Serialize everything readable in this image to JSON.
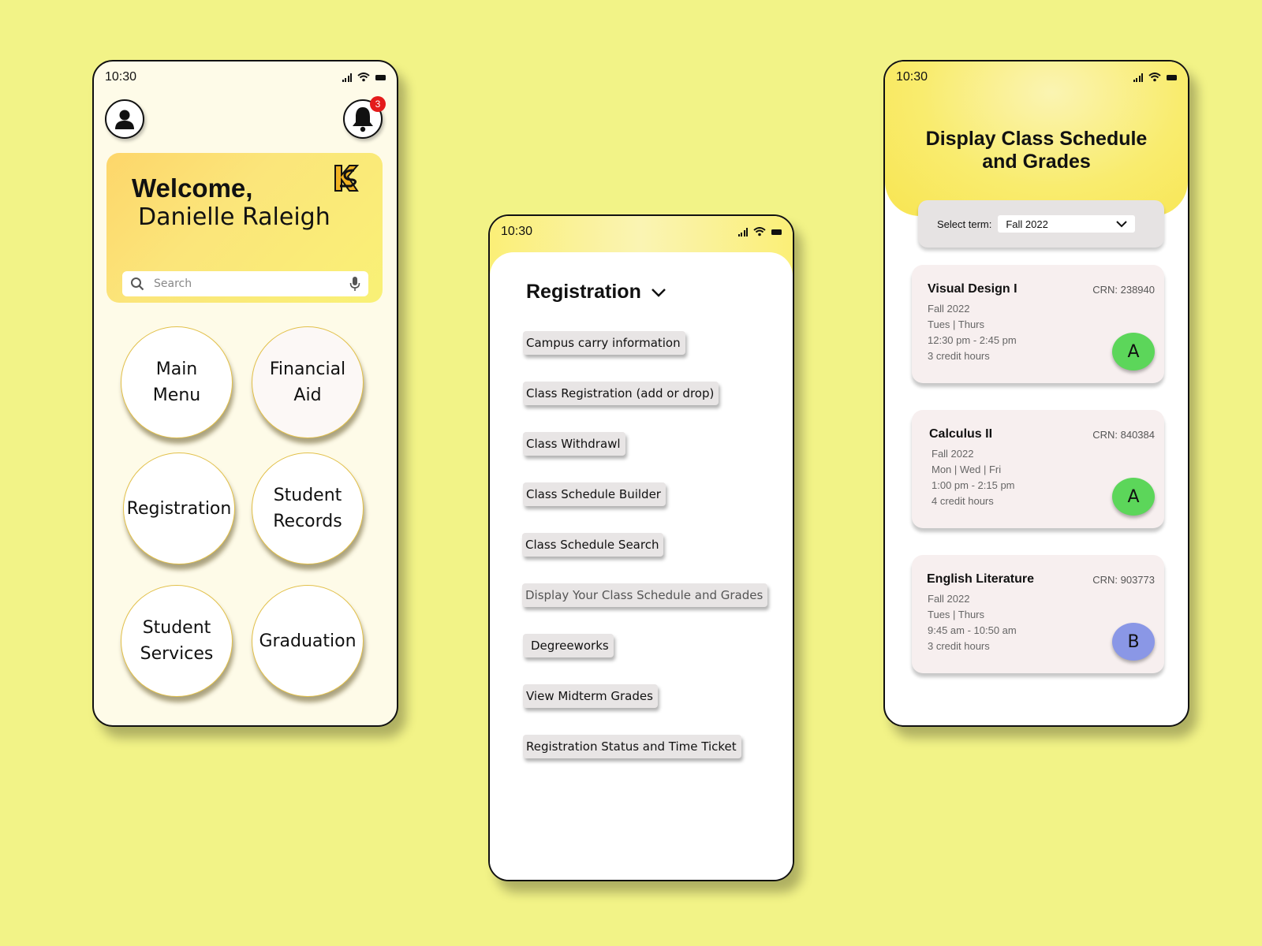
{
  "home": {
    "time": "10:30",
    "notification_count": "3",
    "welcome_title": "Welcome,",
    "user_name": "Danielle Raleigh",
    "search": {
      "placeholder": "Search"
    },
    "menu": [
      "Main\nMenu",
      "Financial\nAid",
      "Registration",
      "Student\nRecords",
      "Student\nServices",
      "Graduation"
    ]
  },
  "registration": {
    "time": "10:30",
    "heading": "Registration",
    "items": [
      "Campus carry information",
      "Class Registration (add or drop)",
      "Class Withdrawl",
      "Class Schedule Builder",
      "Class Schedule Search",
      "Display Your Class Schedule and Grades",
      "Degreeworks",
      "View Midterm Grades",
      "Registration Status and Time Ticket"
    ]
  },
  "schedule": {
    "time": "10:30",
    "title_line1": "Display Class Schedule",
    "title_line2": "and Grades",
    "term_label": "Select term:",
    "term_value": "Fall 2022",
    "courses": [
      {
        "name": "Visual Design I",
        "crn": "CRN: 238940",
        "term": "Fall 2022",
        "days": "Tues | Thurs",
        "time": "12:30 pm - 2:45 pm",
        "credits": "3 credit hours",
        "grade": "A"
      },
      {
        "name": "Calculus II",
        "crn": "CRN: 840384",
        "term": "Fall 2022",
        "days": "Mon | Wed | Fri",
        "time": "1:00 pm - 2:15 pm",
        "credits": "4 credit hours",
        "grade": "A"
      },
      {
        "name": "English Literature",
        "crn": "CRN: 903773",
        "term": "Fall 2022",
        "days": "Tues | Thurs",
        "time": "9:45 am - 10:50 am",
        "credits": "3 credit hours",
        "grade": "B"
      }
    ]
  },
  "colors": {
    "background": "#f2f387",
    "grade_a": "#5cd65a",
    "grade_b": "#8a97e6",
    "badge": "#e41b1b",
    "accent_yellow": "#f9ec6e"
  }
}
